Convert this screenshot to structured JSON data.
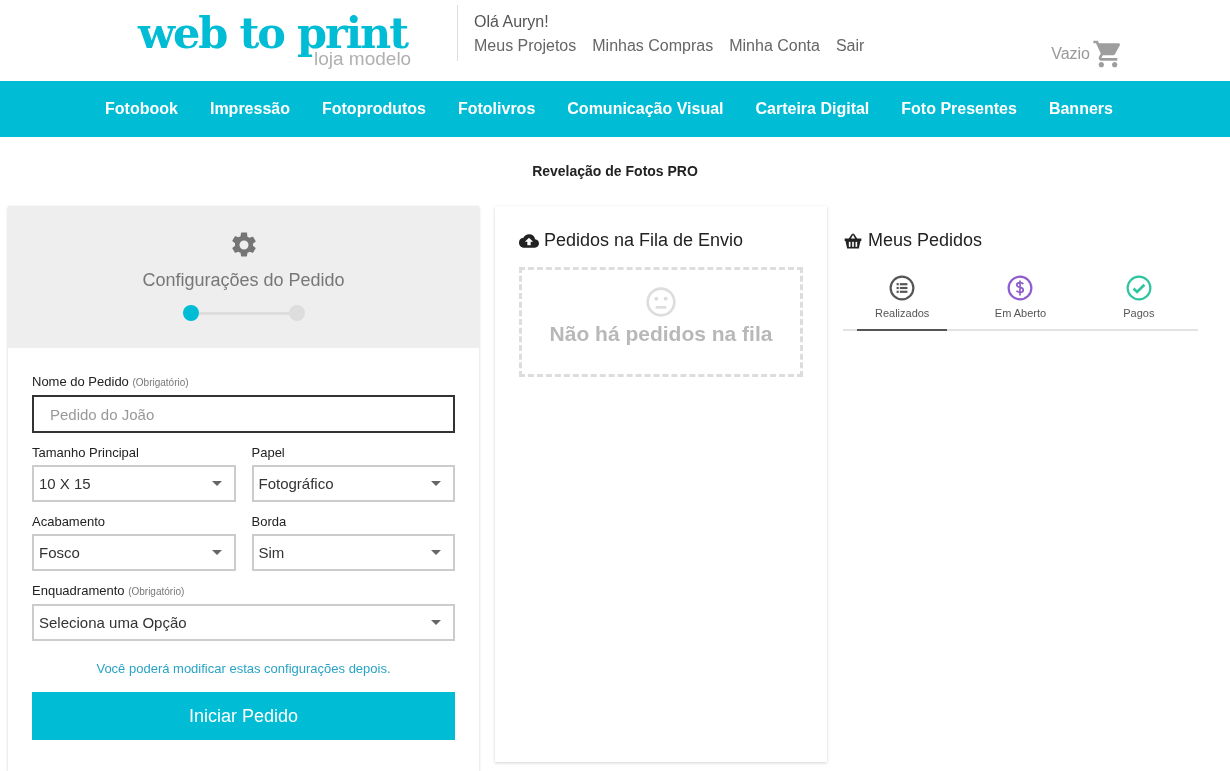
{
  "header": {
    "logo": {
      "title": "web to print",
      "subtitle": "loja modelo"
    },
    "greeting": "Olá Auryn!",
    "user_links": [
      "Meus Projetos",
      "Minhas Compras",
      "Minha Conta",
      "Sair"
    ],
    "cart": {
      "label": "Vazio"
    }
  },
  "nav": [
    "Fotobook",
    "Impressão",
    "Fotoprodutos",
    "Fotolivros",
    "Comunicação Visual",
    "Carteira Digital",
    "Foto Presentes",
    "Banners"
  ],
  "page_title": "Revelação de Fotos PRO",
  "config_panel": {
    "title": "Configurações do Pedido",
    "steps": [
      {
        "active": true
      },
      {
        "active": false
      }
    ],
    "fields": [
      {
        "kind": "text",
        "label": "Nome do Pedido",
        "note": "(Obrigatório)",
        "placeholder": "Pedido do João",
        "focused": true,
        "wide": true
      },
      {
        "kind": "select",
        "label": "Tamanho Principal",
        "value": "10 X 15",
        "wide": false
      },
      {
        "kind": "select",
        "label": "Papel",
        "value": "Fotográfico",
        "wide": false
      },
      {
        "kind": "select",
        "label": "Acabamento",
        "value": "Fosco",
        "wide": false
      },
      {
        "kind": "select",
        "label": "Borda",
        "value": "Sim",
        "wide": false
      },
      {
        "kind": "select",
        "label": "Enquadramento",
        "note": "(Obrigatório)",
        "value": "Seleciona uma Opção",
        "wide": true
      }
    ],
    "hint": "Você poderá modificar estas configurações depois.",
    "button": "Iniciar Pedido"
  },
  "queue_panel": {
    "title": "Pedidos na Fila de Envio",
    "empty_message": "Não há pedidos na fila"
  },
  "orders_panel": {
    "title": "Meus Pedidos",
    "tabs": [
      {
        "kind": "list",
        "label": "Realizados",
        "color": "#555555",
        "selected": true
      },
      {
        "kind": "dollar",
        "label": "Em Aberto",
        "color": "#8e5ccf",
        "selected": false
      },
      {
        "kind": "check",
        "label": "Pagos",
        "color": "#2ec4a0",
        "selected": false
      }
    ]
  }
}
